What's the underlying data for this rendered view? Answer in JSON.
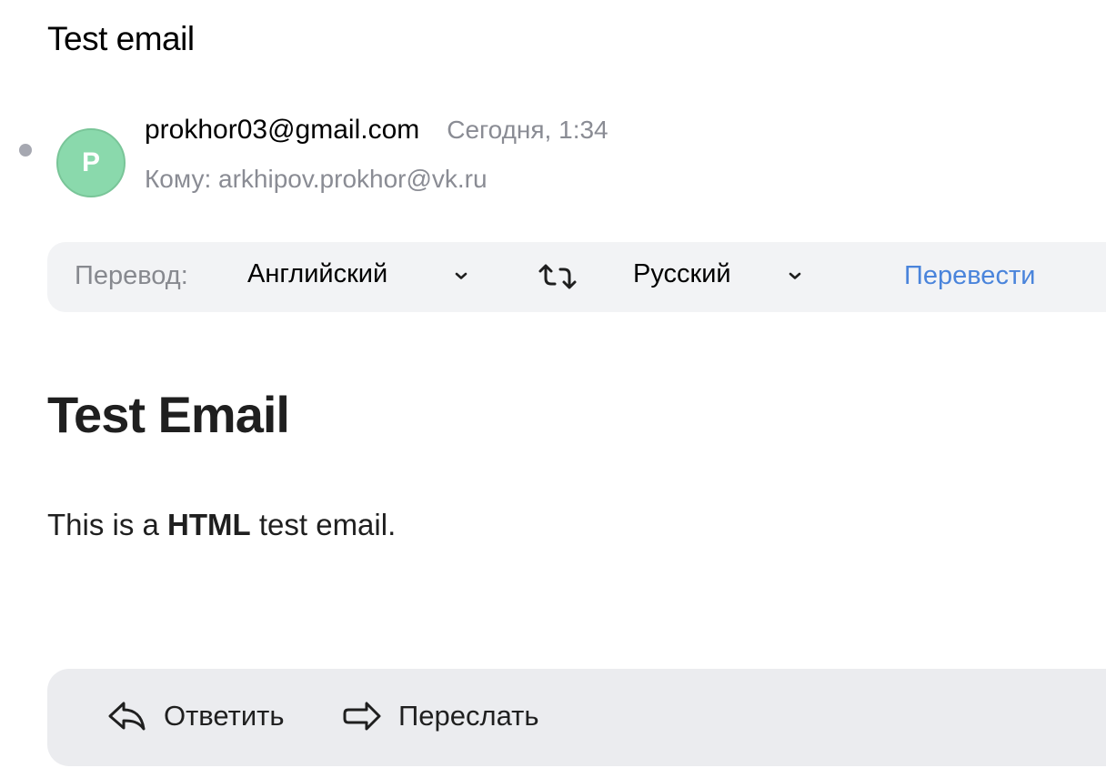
{
  "message": {
    "subject": "Test email",
    "sender": {
      "avatar_letter": "P",
      "avatar_color": "#8ad9ac",
      "address": "prokhor03@gmail.com"
    },
    "date": "Сегодня, 1:34",
    "recipient_line": "Кому: arkhipov.prokhor@vk.ru",
    "unread": true
  },
  "translate_bar": {
    "label": "Перевод:",
    "source_language": "Английский",
    "target_language": "Русский",
    "swap_icon": "swap-languages-icon",
    "translate_button": "Перевести",
    "accent_color": "#4a84db"
  },
  "body": {
    "heading": "Test Email",
    "text_before": "This is a ",
    "text_bold": "HTML",
    "text_after": " test email."
  },
  "actions": {
    "reply_label": "Ответить",
    "reply_icon": "reply-icon",
    "forward_label": "Переслать",
    "forward_icon": "forward-icon"
  }
}
